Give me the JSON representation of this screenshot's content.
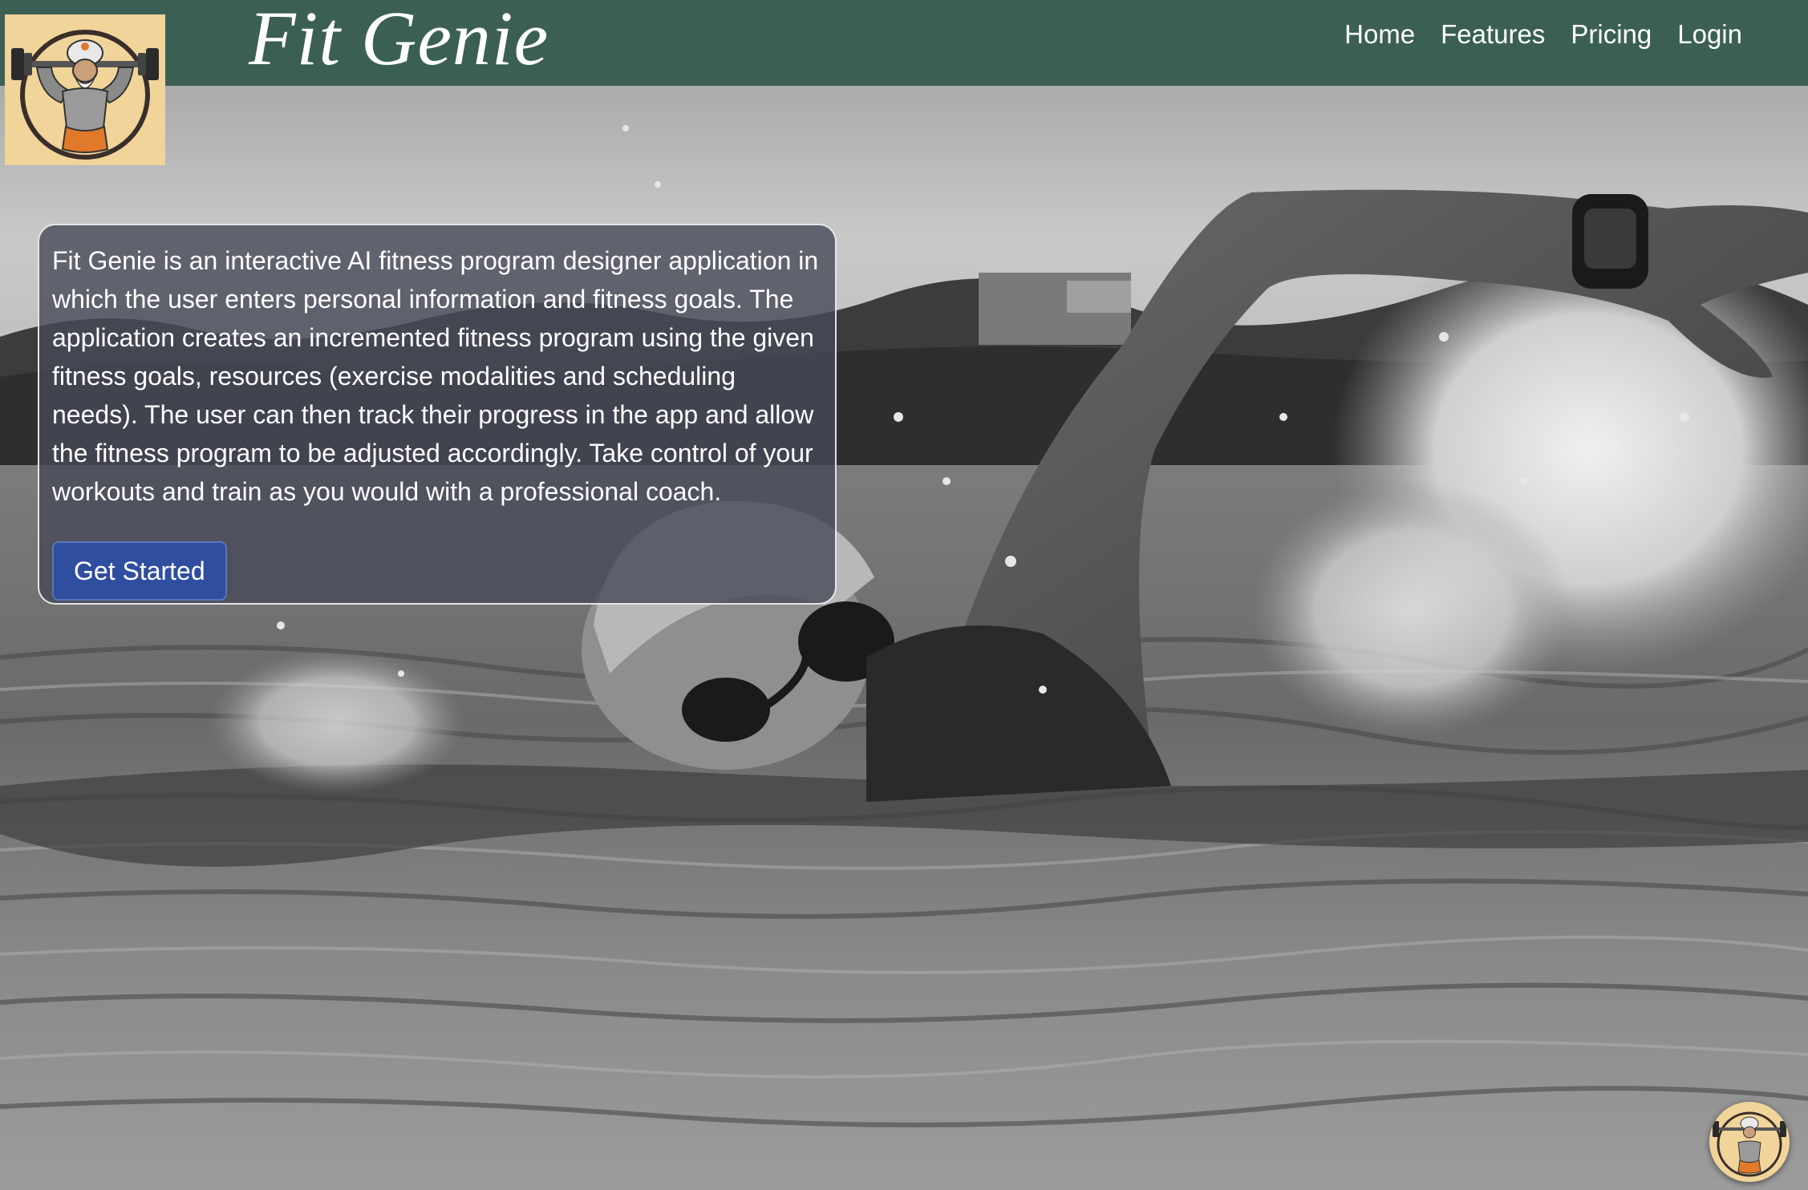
{
  "header": {
    "brand_title": "Fit Genie",
    "logo_icon": "genie-weightlifter-logo-icon",
    "nav": [
      {
        "label": "Home"
      },
      {
        "label": "Features"
      },
      {
        "label": "Pricing"
      },
      {
        "label": "Login"
      }
    ],
    "background_color": "#3c5f55"
  },
  "hero": {
    "image_icon": "swimmer-photo",
    "intro_text": "Fit Genie is an interactive AI fitness program designer application in which the user enters personal information and fitness goals. The application creates an incremented fitness program using the given fitness goals, resources (exercise modalities and scheduling needs). The user can then track their progress in the app and allow the fitness program to be adjusted accordingly. Take control of your workouts and train as you would with a professional coach.",
    "cta_label": "Get Started",
    "cta_color": "#2f4ea0"
  },
  "floating_badge": {
    "icon": "genie-weightlifter-logo-icon"
  }
}
